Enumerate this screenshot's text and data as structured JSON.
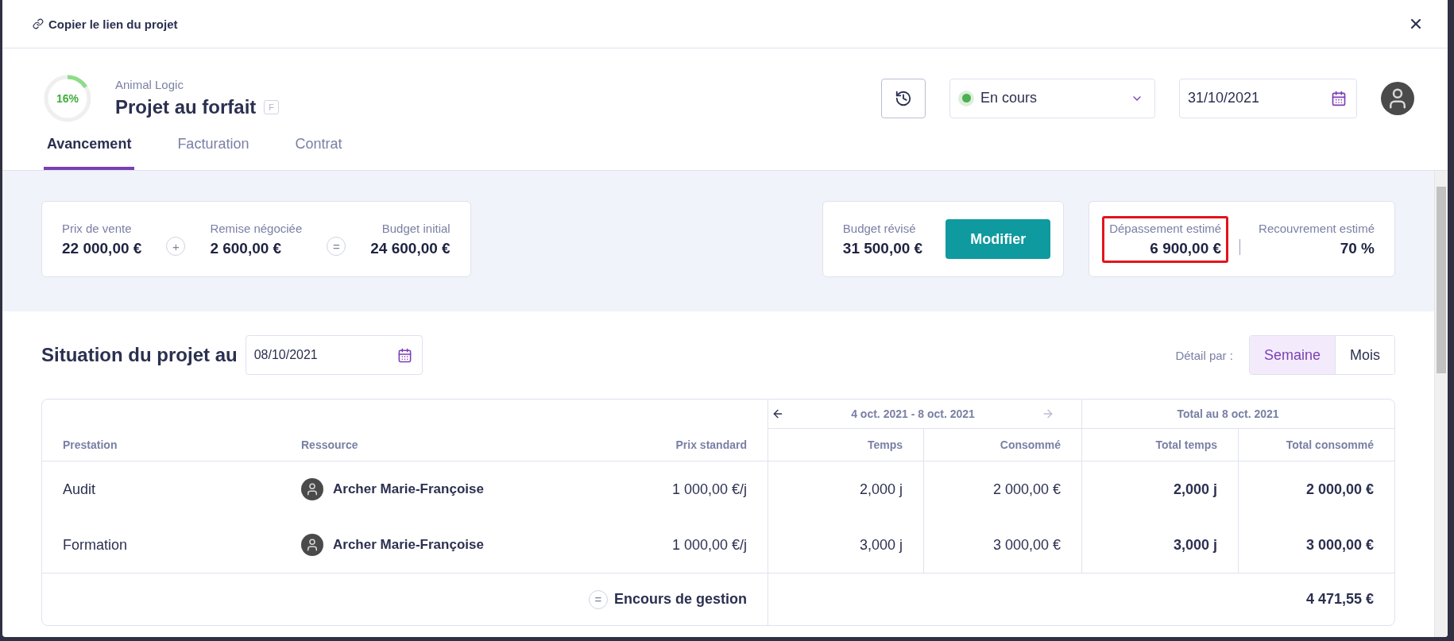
{
  "header": {
    "link": "Copier le lien du projet"
  },
  "project": {
    "progress_label": "16%",
    "level": 0.16,
    "client": "Animal Logic",
    "title": "Projet au forfait",
    "badge": "F"
  },
  "status": {
    "label": "En cours",
    "color": "#4caf50"
  },
  "due_date": "31/10/2021",
  "tabs": [
    {
      "label": "Avancement",
      "selected": true
    },
    {
      "label": "Facturation",
      "selected": false
    },
    {
      "label": "Contrat",
      "selected": false
    }
  ],
  "budget": {
    "items": [
      {
        "label": "Prix de vente",
        "value": "22 000,00 €"
      },
      {
        "label": "Remise négociée",
        "value": "2 600,00 €"
      },
      {
        "label": "Budget initial",
        "value": "24 600,00 €"
      }
    ],
    "operators": [
      "+",
      "="
    ]
  },
  "revised": {
    "label": "Budget révisé",
    "value": "31 500,00 €",
    "button": "Modifier"
  },
  "estimates": [
    {
      "label": "Dépassement estimé",
      "value": "6 900,00 €",
      "highlighted": true
    },
    {
      "label": "Recouvrement estimé",
      "value": "70 %",
      "highlighted": false
    }
  ],
  "situation": {
    "title": "Situation du projet au",
    "date": "08/10/2021",
    "detail_label": "Détail par :",
    "periods": [
      {
        "label": "Semaine",
        "selected": true
      },
      {
        "label": "Mois",
        "selected": false
      }
    ]
  },
  "table": {
    "period": "4 oct. 2021 - 8 oct. 2021",
    "previous_disabled": false,
    "next_disabled": true,
    "total_heading": "Total au 8 oct. 2021",
    "columns": [
      "Prestation",
      "Ressource",
      "Prix standard",
      "Temps",
      "Consommé",
      "Total temps",
      "Total consommé"
    ],
    "rows": [
      {
        "prestation": "Audit",
        "resource": "Archer Marie-Françoise",
        "price": "1 000,00 €/j",
        "time": "2,000 j",
        "consumed": "2 000,00 €",
        "total_time": "2,000 j",
        "total_consumed": "2 000,00 €"
      },
      {
        "prestation": "Formation",
        "resource": "Archer Marie-Françoise",
        "price": "1 000,00 €/j",
        "time": "3,000 j",
        "consumed": "3 000,00 €",
        "total_time": "3,000 j",
        "total_consumed": "3 000,00 €"
      }
    ],
    "footer": {
      "operator": "=",
      "label": "Encours de gestion",
      "value": "4 471,55 €"
    }
  }
}
